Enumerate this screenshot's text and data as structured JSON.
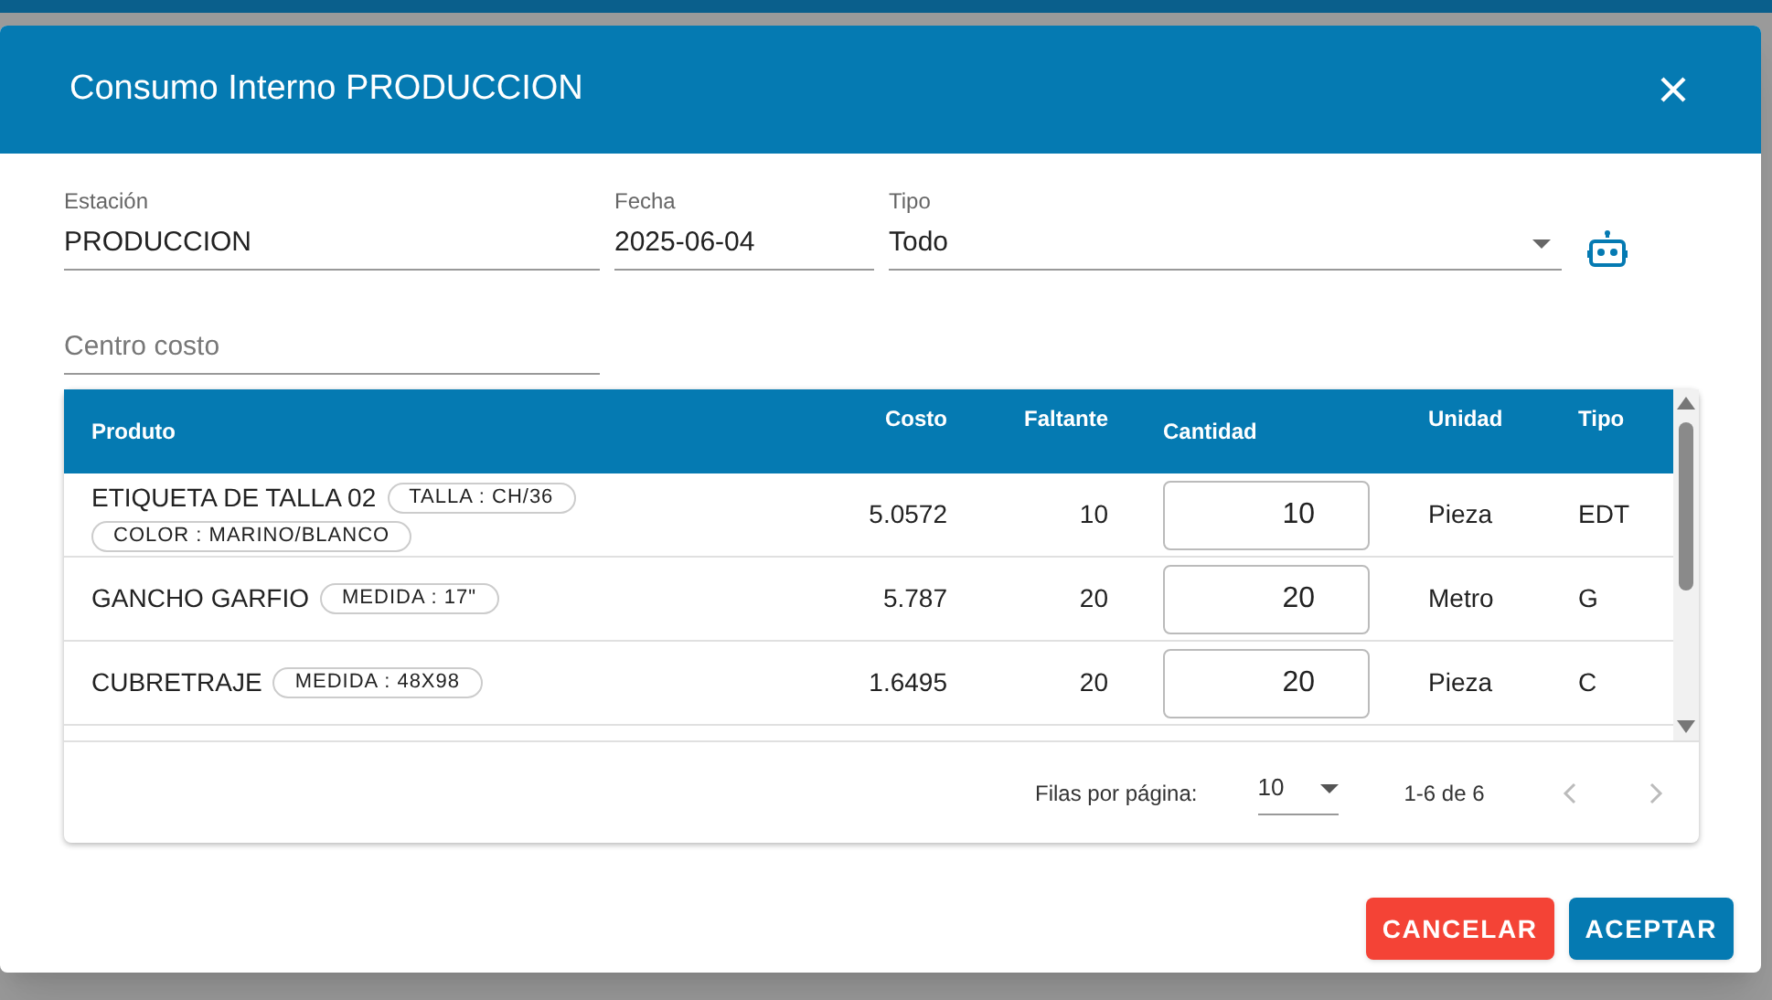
{
  "dialog": {
    "title": "Consumo Interno PRODUCCION"
  },
  "fields": [
    {
      "kind": "text",
      "label": "Estación",
      "value": "PRODUCCION"
    },
    {
      "kind": "text",
      "label": "Fecha",
      "value": "2025-06-04"
    },
    {
      "kind": "select",
      "label": "Tipo",
      "value": "Todo"
    }
  ],
  "cost_center": {
    "placeholder": "Centro costo"
  },
  "table": {
    "columns": [
      "Produto",
      "Costo",
      "Faltante",
      "Cantidad",
      "Unidad",
      "Tipo"
    ],
    "rows": [
      {
        "product": "ETIQUETA DE TALLA 02",
        "tags": [
          "TALLA : CH/36",
          "COLOR : MARINO/BLANCO"
        ],
        "cost": "5.0572",
        "missing": "10",
        "quantity": "10",
        "unit": "Pieza",
        "type": "EDT"
      },
      {
        "product": "GANCHO GARFIO",
        "tags": [
          "MEDIDA : 17\""
        ],
        "cost": "5.787",
        "missing": "20",
        "quantity": "20",
        "unit": "Metro",
        "type": "G"
      },
      {
        "product": "CUBRETRAJE",
        "tags": [
          "MEDIDA : 48X98"
        ],
        "cost": "1.6495",
        "missing": "20",
        "quantity": "20",
        "unit": "Pieza",
        "type": "C"
      }
    ]
  },
  "pagination": {
    "rows_label": "Filas por página:",
    "rows_per_page": "10",
    "range": "1-6 de 6",
    "prev_disabled": true,
    "next_disabled": true
  },
  "buttons": [
    {
      "kind": "cancel",
      "label": "CANCELAR"
    },
    {
      "kind": "accept",
      "label": "ACEPTAR"
    }
  ]
}
